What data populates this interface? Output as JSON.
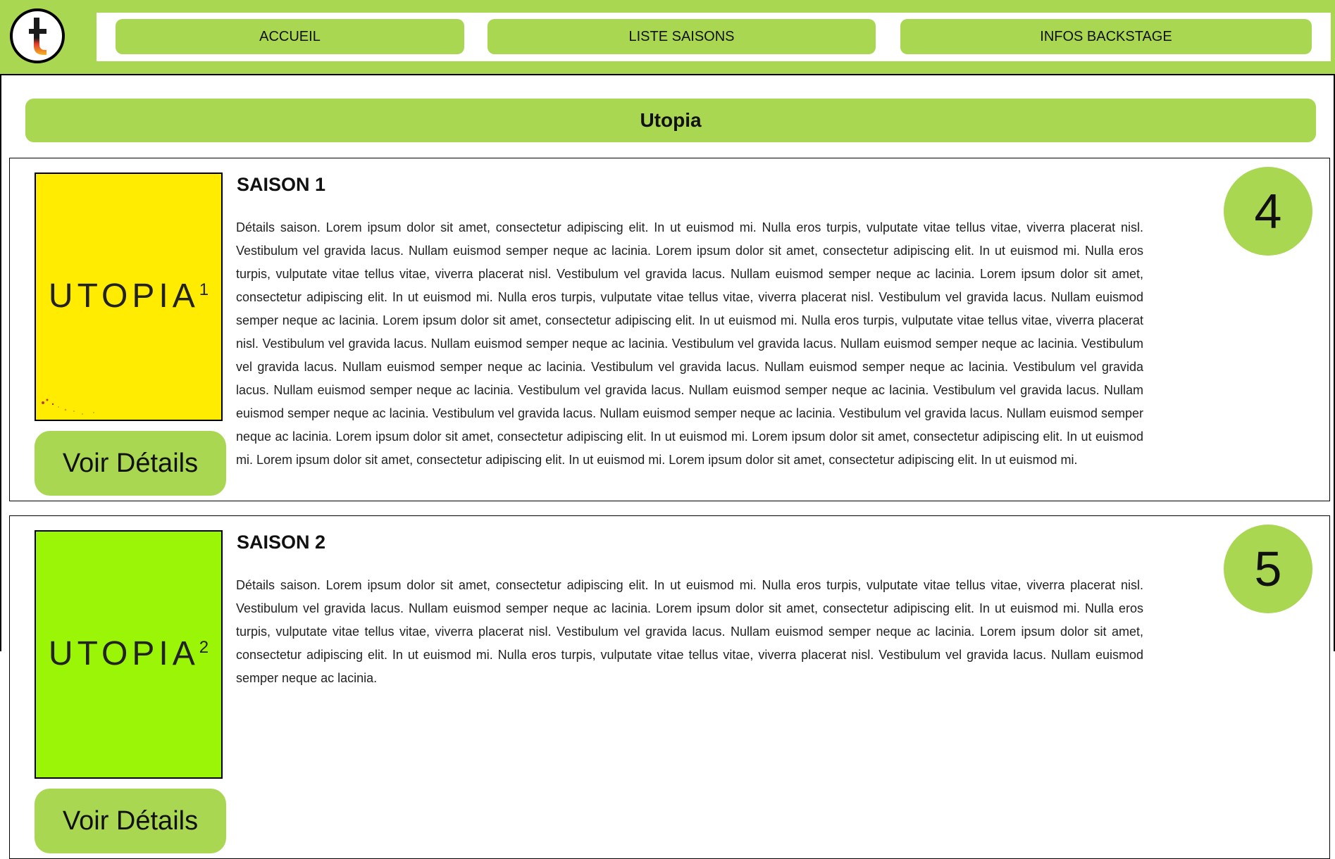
{
  "header": {
    "logo_icon": "tv-t-logo",
    "nav": [
      {
        "label": "ACCUEIL"
      },
      {
        "label": "LISTE SAISONS"
      },
      {
        "label": "INFOS BACKSTAGE"
      }
    ]
  },
  "show": {
    "title": "Utopia"
  },
  "seasons": [
    {
      "title": "SAISON 1",
      "poster_text": "UTOPIA",
      "poster_number": "1",
      "poster_color": "#ffec00",
      "episodes": "4",
      "button": "Voir Détails",
      "description": "Détails saison. Lorem ipsum dolor sit amet, consectetur adipiscing elit. In ut euismod mi. Nulla eros turpis, vulputate vitae tellus vitae, viverra placerat nisl. Vestibulum vel gravida lacus. Nullam euismod semper neque ac lacinia. Lorem ipsum dolor sit amet, consectetur adipiscing elit. In ut euismod mi. Nulla eros turpis, vulputate vitae tellus vitae, viverra placerat nisl. Vestibulum vel gravida lacus. Nullam euismod semper neque ac lacinia. Lorem ipsum dolor sit amet, consectetur adipiscing elit. In ut euismod mi. Nulla eros turpis, vulputate vitae tellus vitae, viverra placerat nisl. Vestibulum vel gravida lacus. Nullam euismod semper neque ac lacinia. Lorem ipsum dolor sit amet, consectetur adipiscing elit. In ut euismod mi. Nulla eros turpis, vulputate vitae tellus vitae, viverra placerat nisl. Vestibulum vel gravida lacus. Nullam euismod semper neque ac lacinia. Vestibulum vel gravida lacus. Nullam euismod semper neque ac lacinia. Vestibulum vel gravida lacus. Nullam euismod semper neque ac lacinia. Vestibulum vel gravida lacus. Nullam euismod semper neque ac lacinia. Vestibulum vel gravida lacus. Nullam euismod semper neque ac lacinia. Vestibulum vel gravida lacus. Nullam euismod semper neque ac lacinia. Vestibulum vel gravida lacus. Nullam euismod semper neque ac lacinia. Vestibulum vel gravida lacus. Nullam euismod semper neque ac lacinia. Vestibulum vel gravida lacus. Nullam euismod semper neque ac lacinia. Lorem ipsum dolor sit amet, consectetur adipiscing elit. In ut euismod mi. Lorem ipsum dolor sit amet, consectetur adipiscing elit. In ut euismod mi. Lorem ipsum dolor sit amet, consectetur adipiscing elit. In ut euismod mi. Lorem ipsum dolor sit amet, consectetur adipiscing elit. In ut euismod mi."
    },
    {
      "title": "SAISON 2",
      "poster_text": "UTOPIA",
      "poster_number": "2",
      "poster_color": "#9af507",
      "episodes": "5",
      "button": "Voir Détails",
      "description": "Détails saison. Lorem ipsum dolor sit amet, consectetur adipiscing elit. In ut euismod mi. Nulla eros turpis, vulputate vitae tellus vitae, viverra placerat nisl. Vestibulum vel gravida lacus. Nullam euismod semper neque ac lacinia. Lorem ipsum dolor sit amet, consectetur adipiscing elit. In ut euismod mi. Nulla eros turpis, vulputate vitae tellus vitae, viverra placerat nisl. Vestibulum vel gravida lacus. Nullam euismod semper neque ac lacinia. Lorem ipsum dolor sit amet, consectetur adipiscing elit. In ut euismod mi. Nulla eros turpis, vulputate vitae tellus vitae, viverra placerat nisl. Vestibulum vel gravida lacus. Nullam euismod semper neque ac lacinia."
    }
  ],
  "colors": {
    "accent": "#a9d752"
  }
}
